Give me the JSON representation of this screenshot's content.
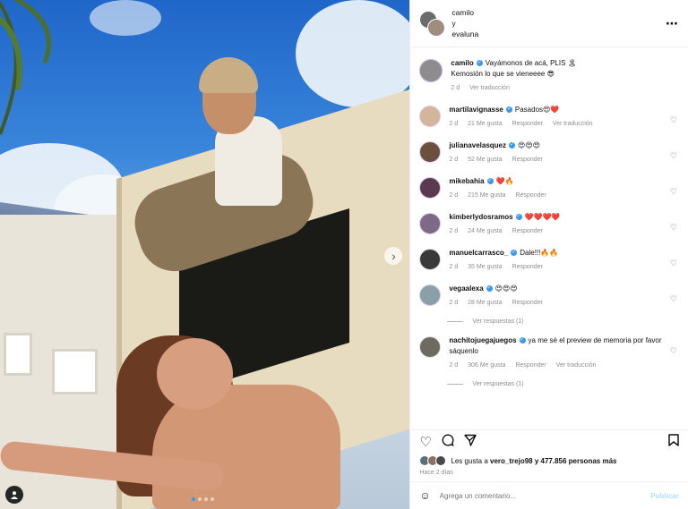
{
  "header": {
    "author": "camilo",
    "connector": "y",
    "coauthor": "evaluna",
    "more_icon": "⋯"
  },
  "caption": {
    "user": "camilo",
    "line1": "Vayámonos de acá, PLIS 🏝",
    "line2": "Kemosión lo que se vieneeee 😎",
    "time": "2 d",
    "translate": "Ver traducción"
  },
  "comments": [
    {
      "user": "martilavignasse",
      "text": "Pasados😍❤️",
      "time": "2 d",
      "likes": "21 Me gusta",
      "reply": "Responder",
      "translate": "Ver traducción"
    },
    {
      "user": "julianavelasquez",
      "text": "😍😍😍",
      "time": "2 d",
      "likes": "52 Me gusta",
      "reply": "Responder",
      "translate": ""
    },
    {
      "user": "mikebahia",
      "text": "❤️🔥",
      "time": "2 d",
      "likes": "215 Me gusta",
      "reply": "Responder",
      "translate": ""
    },
    {
      "user": "kimberlydosramos",
      "text": "❤️❤️❤️❤️",
      "time": "2 d",
      "likes": "24 Me gusta",
      "reply": "Responder",
      "translate": ""
    },
    {
      "user": "manuelcarrasco_",
      "text": "Dale!!!🔥🔥",
      "time": "2 d",
      "likes": "35 Me gusta",
      "reply": "Responder",
      "translate": ""
    },
    {
      "user": "vegaalexa",
      "text": "😍😍😍",
      "time": "2 d",
      "likes": "28 Me gusta",
      "reply": "Responder",
      "translate": ""
    },
    {
      "user": "nachitojuegajuegos",
      "text": "ya me sé el preview de memoria por favor sáquenlo",
      "time": "2 d",
      "likes": "306 Me gusta",
      "reply": "Responder",
      "translate": "Ver traducción"
    }
  ],
  "view_replies": [
    "Ver respuestas (1)",
    "Ver respuestas (1)"
  ],
  "likes_line": {
    "prefix": "Les gusta a",
    "user": "vero_trejo98",
    "suffix": "y 477.856 personas más"
  },
  "posted": "Hace 2 días",
  "add_comment": {
    "placeholder": "Agrega un comentario...",
    "post_label": "Publicar"
  }
}
